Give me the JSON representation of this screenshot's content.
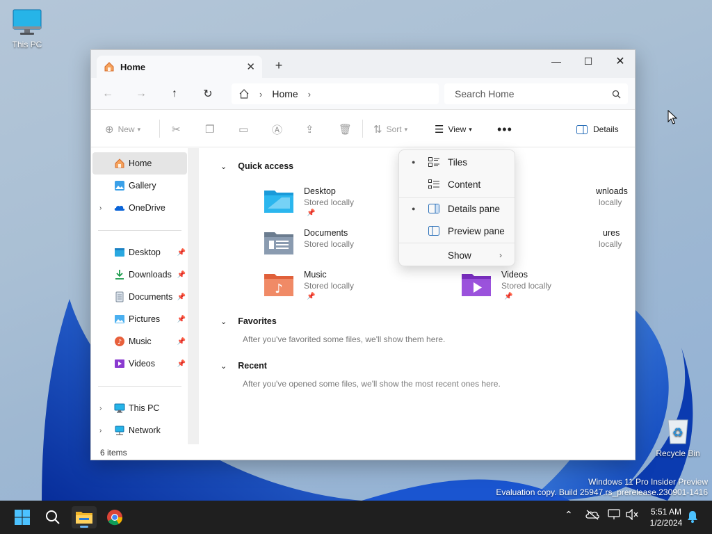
{
  "desktop": {
    "icons": [
      {
        "label": "This PC"
      },
      {
        "label": "Recycle Bin"
      }
    ]
  },
  "explorer": {
    "tab": {
      "title": "Home"
    },
    "address": {
      "path": [
        "Home"
      ],
      "search_placeholder": "Search Home"
    },
    "commands": {
      "new": "New",
      "sort": "Sort",
      "view": "View",
      "details": "Details"
    },
    "sidebar": {
      "top": [
        {
          "label": "Home"
        },
        {
          "label": "Gallery"
        },
        {
          "label": "OneDrive"
        }
      ],
      "pinned": [
        {
          "label": "Desktop"
        },
        {
          "label": "Downloads"
        },
        {
          "label": "Documents"
        },
        {
          "label": "Pictures"
        },
        {
          "label": "Music"
        },
        {
          "label": "Videos"
        }
      ],
      "bottom": [
        {
          "label": "This PC"
        },
        {
          "label": "Network"
        }
      ]
    },
    "quick_access": {
      "title": "Quick access",
      "items": [
        {
          "name": "Desktop",
          "sub": "Stored locally"
        },
        {
          "name": "wnloads",
          "sub": "locally"
        },
        {
          "name": "Documents",
          "sub": "Stored locally"
        },
        {
          "name": "ures",
          "sub": "locally"
        },
        {
          "name": "Music",
          "sub": "Stored locally"
        },
        {
          "name": "Videos",
          "sub": "Stored locally"
        }
      ]
    },
    "favorites": {
      "title": "Favorites",
      "note": "After you've favorited some files, we'll show them here."
    },
    "recent": {
      "title": "Recent",
      "note": "After you've opened some files, we'll show the most recent ones here."
    },
    "status": "6 items"
  },
  "view_menu": {
    "items": [
      {
        "label": "Tiles",
        "checked": true
      },
      {
        "label": "Content",
        "checked": false
      },
      {
        "label": "Details pane",
        "checked": true
      },
      {
        "label": "Preview pane",
        "checked": false
      },
      {
        "label": "Show",
        "submenu": true
      }
    ]
  },
  "watermark": {
    "line1": "Windows 11 Pro Insider Preview",
    "line2": "Evaluation copy. Build 25947.rs_prerelease.230901-1416"
  },
  "taskbar": {
    "time": "5:51 AM",
    "date": "1/2/2024"
  },
  "colors": {
    "accent": "#0a64d8",
    "folder_blue": "#1a9ad9",
    "taskbar": "#1f1f1f"
  }
}
